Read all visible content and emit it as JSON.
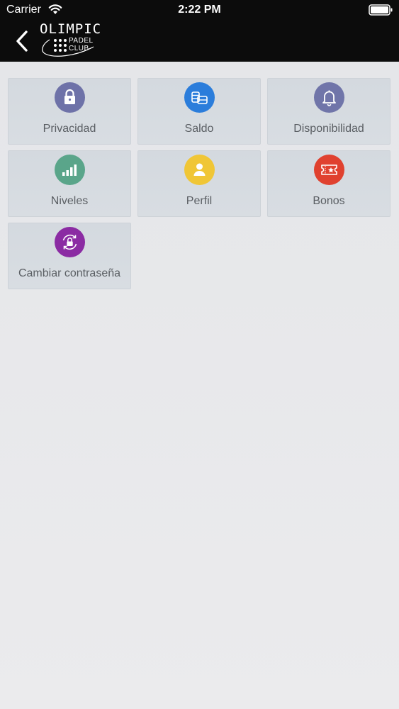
{
  "status_bar": {
    "carrier": "Carrier",
    "time": "2:22 PM"
  },
  "nav": {
    "logo_title": "OLIMPIC",
    "logo_line1": "PADEL",
    "logo_line2": "CLUB"
  },
  "menu": {
    "items": [
      {
        "label": "Privacidad",
        "icon": "lock-icon",
        "color": "#6e72a8"
      },
      {
        "label": "Saldo",
        "icon": "coins-icon",
        "color": "#2b7ddb"
      },
      {
        "label": "Disponibilidad",
        "icon": "bell-icon",
        "color": "#7075a9"
      },
      {
        "label": "Niveles",
        "icon": "signal-bars-icon",
        "color": "#5aa58a"
      },
      {
        "label": "Perfil",
        "icon": "user-icon",
        "color": "#f0c636"
      },
      {
        "label": "Bonos",
        "icon": "ticket-icon",
        "color": "#e0412f"
      },
      {
        "label": "Cambiar contraseña",
        "icon": "lock-refresh-icon",
        "color": "#8b2ba3"
      }
    ]
  }
}
